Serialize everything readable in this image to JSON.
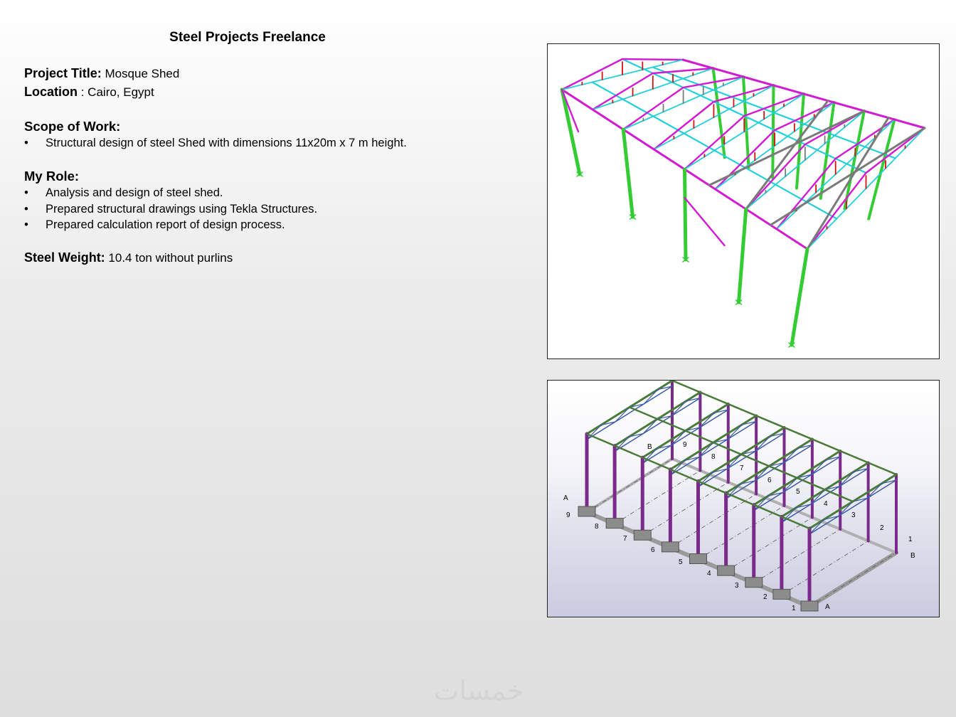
{
  "title": "Steel Projects Freelance",
  "project": {
    "title_label": "Project Title:",
    "title_value": "Mosque Shed",
    "location_label": "Location",
    "location_value": ": Cairo, Egypt"
  },
  "scope": {
    "heading": "Scope of Work:",
    "items": [
      "Structural design of steel Shed with dimensions 11x20m x 7 m height."
    ]
  },
  "role": {
    "heading": "My Role:",
    "items": [
      "Analysis and design of steel shed.",
      "Prepared structural drawings using Tekla Structures.",
      "Prepared calculation report of design process."
    ]
  },
  "weight": {
    "label": "Steel Weight:",
    "value": "10.4 ton without purlins"
  },
  "model2_labels": {
    "numbers_front": [
      "9",
      "8",
      "7",
      "6",
      "5",
      "4",
      "3",
      "2",
      "1"
    ],
    "numbers_back": [
      "1",
      "2",
      "3",
      "4",
      "5",
      "6",
      "7",
      "8",
      "9"
    ],
    "axis_a": "A",
    "axis_b": "B"
  },
  "watermark": "خمسات",
  "colors": {
    "column_green": "#33cc33",
    "bracing_magenta": "#d21ad2",
    "purlin_cyan": "#22d0d8",
    "truss_red": "#d81010",
    "truss_grey": "#7a7a7a",
    "tekla_column": "#7a2a8a",
    "tekla_truss": "#3a5aa8",
    "tekla_chord": "#4a7a3a"
  }
}
